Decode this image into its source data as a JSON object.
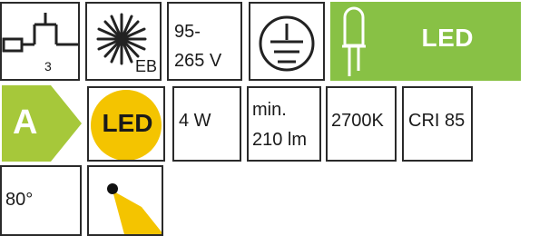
{
  "tiles": {
    "dimming": {
      "subscript": "3"
    },
    "ballast": {
      "subscript": "EB"
    },
    "voltage": {
      "line1": "95-",
      "line2": "265 V"
    },
    "earth": {},
    "led_source": {
      "label": "LED"
    },
    "energy_class": {
      "label": "A"
    },
    "led_circle": {
      "label": "LED"
    },
    "power": {
      "label": "4 W"
    },
    "lumen": {
      "line1": "min.",
      "line2": "210 lm"
    },
    "color_temperature": {
      "label": "2700K"
    },
    "cri": {
      "label": "CRI 85"
    },
    "beam_angle": {
      "label": "80°"
    },
    "light_direction": {}
  },
  "colors": {
    "led_green": "#88c145",
    "energy_green_triangle": "#a6c83a",
    "energy_yellow": "#f4c400",
    "beam_yellow": "#f4c400",
    "border": "#2a2a2a"
  }
}
